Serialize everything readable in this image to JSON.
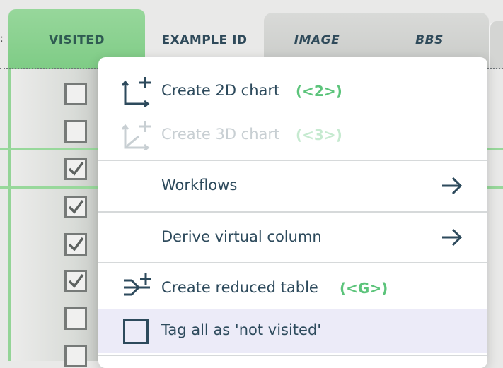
{
  "table": {
    "left_edge_mark": ":",
    "columns": {
      "visited": "VISITED",
      "example_id": "EXAMPLE ID",
      "image": "IMAGE",
      "bbs": "BBS"
    },
    "visited_checkboxes": [
      false,
      false,
      true,
      true,
      true,
      true,
      false,
      false
    ]
  },
  "menu": {
    "items": [
      {
        "label": "Create 2D chart",
        "shortcut": "(<2>)",
        "icon": "chart-2d-icon",
        "enabled": true
      },
      {
        "label": "Create 3D chart",
        "shortcut": "(<3>)",
        "icon": "chart-3d-icon",
        "enabled": false
      },
      {
        "label": "Workflows",
        "icon": "arrow-right-icon",
        "submenu": true
      },
      {
        "label": "Derive virtual column",
        "icon": "arrow-right-icon",
        "submenu": true
      },
      {
        "label": "Create reduced table",
        "shortcut": "(<G>)",
        "icon": "reduce-table-icon",
        "enabled": true
      },
      {
        "label": "Tag all as 'not visited'",
        "icon": "checkbox-unchecked-icon",
        "highlighted": true
      }
    ]
  },
  "colors": {
    "accent_green": "#5cc47b",
    "visited_header": "#8fd494",
    "text_dark": "#2d4a5c",
    "hover": "#ecebf8"
  }
}
